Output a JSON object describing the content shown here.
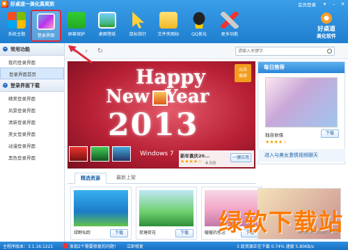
{
  "window": {
    "title": "好桌道一美化真简到",
    "member_login": "会员登录",
    "controls": [
      "▾",
      "–",
      "✕"
    ]
  },
  "toolbar": {
    "items": [
      {
        "label": "系统主题",
        "icon": "windows-logo-icon"
      },
      {
        "label": "登录界面",
        "icon": "login-screen-icon",
        "selected": true
      },
      {
        "label": "屏幕保护",
        "icon": "shield-icon"
      },
      {
        "label": "桌面壁纸",
        "icon": "wallpaper-icon"
      },
      {
        "label": "鼠标指针",
        "icon": "cursor-icon"
      },
      {
        "label": "文件夹图标",
        "icon": "folder-icon"
      },
      {
        "label": "QQ美化",
        "icon": "qq-icon"
      },
      {
        "label": "更多功能",
        "icon": "tools-icon"
      }
    ]
  },
  "brand": {
    "name": "好桌道",
    "subtitle": "美化软件"
  },
  "sidebar": {
    "section1_title": "常用功能",
    "section1_items": [
      "我的登录界面",
      "登录界面首页"
    ],
    "section2_title": "登录界面下载",
    "section2_items": [
      "精美登录界面",
      "风景登录界面",
      "清新登录界面",
      "美女登录界面",
      "动漫登录界面",
      "黑色登录界面"
    ]
  },
  "navbar": {
    "back": "‹",
    "forward": "›",
    "refresh": "↻",
    "search_placeholder": "请输入关键字"
  },
  "banner": {
    "line1": "Happy",
    "line2a": "New",
    "line2b": "Year",
    "line3": "2013",
    "corner": [
      "元旦",
      "推荐"
    ],
    "windows_text": "Windows 7",
    "item_name": "新年喜庆20...",
    "stars": "★★★★☆",
    "score": "4.5分",
    "apply": "一键应用"
  },
  "daily": {
    "title": "每日推荐",
    "name": "独自依偎",
    "stars": "★★★★☆",
    "download": "下载"
  },
  "video_link": "进入与美女激情视频聊天",
  "tabs": {
    "active": "精选资源",
    "inactive": "最新上架"
  },
  "cards": [
    {
      "name": "绿野仙踪",
      "download": "下载"
    },
    {
      "name": "荷塘荷花",
      "download": "下载"
    },
    {
      "name": "暖暖的思念",
      "download": "下载"
    }
  ],
  "watermark": {
    "text": "绿软下载站",
    "url": "www.lhdown.com"
  },
  "statusbar": {
    "version": "主程序版本：3.1.16.1221",
    "alert": "发现2个需要修复的问题！",
    "fix": "立即修复",
    "right": "3 款资源正在下载  0.74%  速度 5.80KB/s"
  }
}
